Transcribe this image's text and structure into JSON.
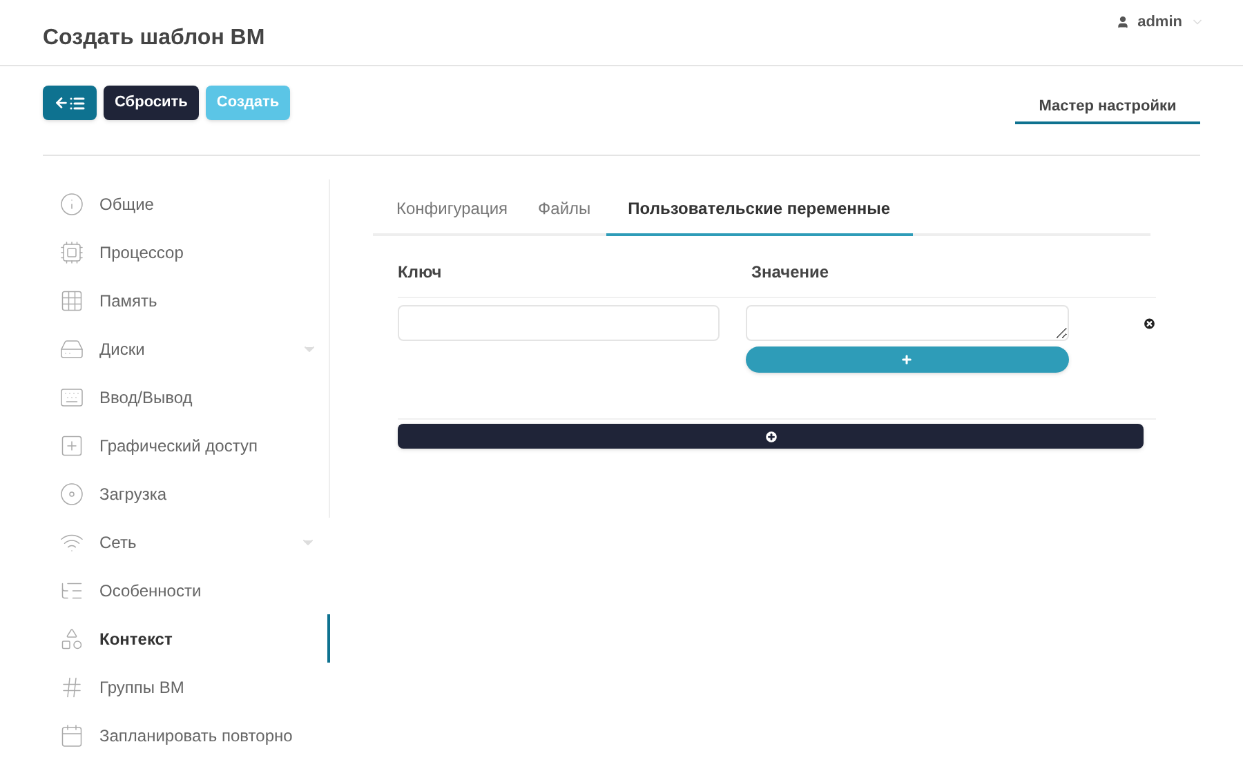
{
  "header": {
    "title": "Создать шаблон ВМ",
    "user": "admin"
  },
  "toolbar": {
    "buttons": [
      {
        "kind": "back"
      },
      {
        "kind": "reset",
        "label": "Сбросить"
      },
      {
        "kind": "create",
        "label": "Создать"
      }
    ]
  },
  "mode_tabs": [
    {
      "label": "Мастер настройки",
      "selected": true
    }
  ],
  "sidebar": {
    "items": [
      {
        "label": "Общие",
        "selected": false,
        "expandable": false
      },
      {
        "label": "Процессор",
        "selected": false,
        "expandable": false
      },
      {
        "label": "Память",
        "selected": false,
        "expandable": false
      },
      {
        "label": "Диски",
        "selected": false,
        "expandable": true
      },
      {
        "label": "Ввод/Вывод",
        "selected": false,
        "expandable": false
      },
      {
        "label": "Графический доступ",
        "selected": false,
        "expandable": false
      },
      {
        "label": "Загрузка",
        "selected": false,
        "expandable": false
      },
      {
        "label": "Сеть",
        "selected": false,
        "expandable": true
      },
      {
        "label": "Особенности",
        "selected": false,
        "expandable": false
      },
      {
        "label": "Контекст",
        "selected": true,
        "expandable": false
      },
      {
        "label": "Группы ВМ",
        "selected": false,
        "expandable": false
      },
      {
        "label": "Запланировать повторно",
        "selected": false,
        "expandable": false
      }
    ]
  },
  "tabs": [
    {
      "label": "Конфигурация",
      "selected": false
    },
    {
      "label": "Файлы",
      "selected": false
    },
    {
      "label": "Пользовательские переменные",
      "selected": true
    }
  ],
  "variables": {
    "columns": [
      "Ключ",
      "Значение"
    ]
  }
}
